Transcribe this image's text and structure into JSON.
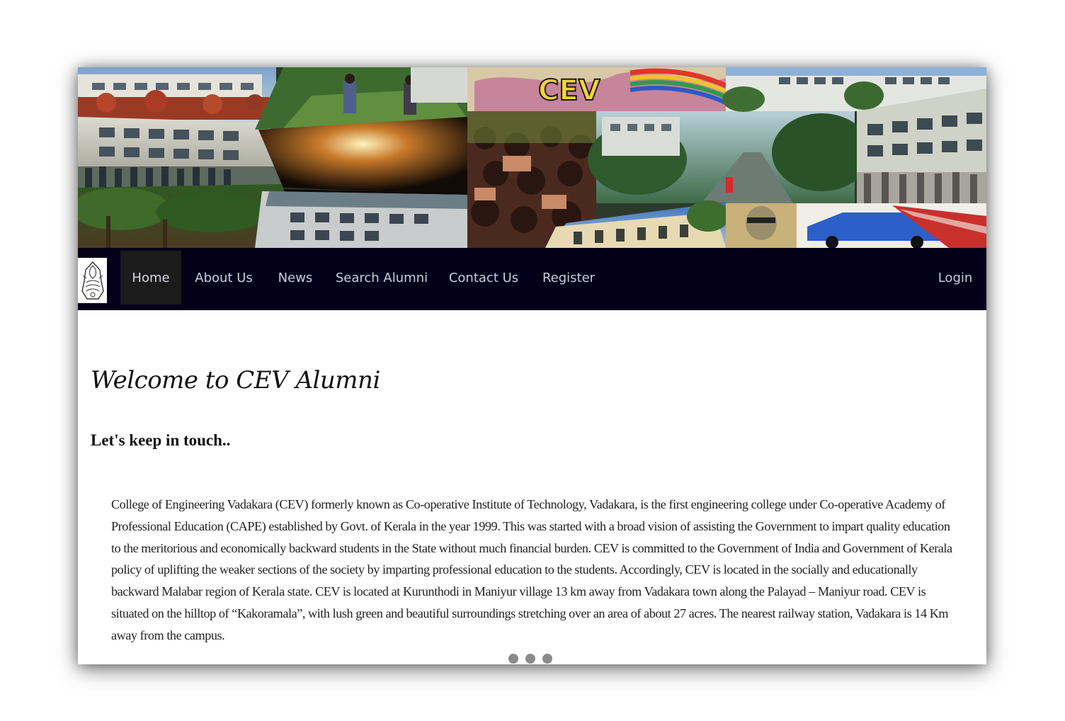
{
  "banner": {
    "graffiti_text": "CEV"
  },
  "logo": {
    "icon": "college-emblem-icon"
  },
  "nav": {
    "items": [
      {
        "label": "Home",
        "active": true
      },
      {
        "label": "About Us"
      },
      {
        "label": "News"
      },
      {
        "label": "Search Alumni"
      },
      {
        "label": "Contact Us"
      },
      {
        "label": "Register"
      }
    ],
    "login_label": "Login"
  },
  "main": {
    "title": "Welcome to CEV Alumni",
    "subtitle": "Let's keep in touch..",
    "intro": "College of Engineering Vadakara (CEV) formerly known as Co-operative Institute of Technology, Vadakara, is the first engineering college under Co-operative Academy of Professional Education (CAPE) established by Govt. of Kerala in the year 1999. This was started with a broad vision of assisting the Government to impart quality education to the meritorious and economically backward students in the State without much financial burden. CEV is committed to the Government of India and Government of Kerala policy of uplifting the weaker sections of the society by imparting professional education to the students. Accordingly, CEV is located in the socially and educationally backward Malabar region of Kerala state. CEV is located at Kurunthodi in Maniyur village 13 km away from Vadakara town along the Palayad – Maniyur road. CEV is situated on the hilltop of “Kakoramala”, with lush green and beautiful surroundings stretching over an area of about 27 acres. The nearest railway station, Vadakara is 14 Km away from the campus."
  },
  "carousel": {
    "slide_count": 3
  }
}
